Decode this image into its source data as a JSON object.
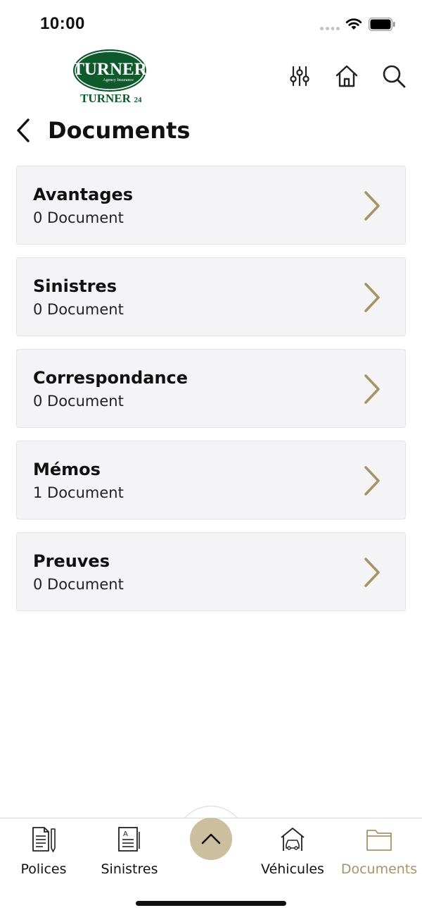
{
  "status_bar": {
    "time": "10:00"
  },
  "brand": {
    "logo_text": "TURNER",
    "logo_subtext": "Agency Insurance",
    "logo_tagline": "TURNER",
    "logo_tagline_suffix": "24"
  },
  "header": {
    "title": "Documents",
    "icons": [
      "sliders-icon",
      "home-icon",
      "search-icon"
    ]
  },
  "documents": [
    {
      "name": "Avantages",
      "count": "0 Document"
    },
    {
      "name": "Sinistres",
      "count": "0 Document"
    },
    {
      "name": "Correspondance",
      "count": "0 Document"
    },
    {
      "name": "Mémos",
      "count": "1 Document"
    },
    {
      "name": "Preuves",
      "count": "0 Document"
    }
  ],
  "tabs": {
    "polices": "Polices",
    "sinistres": "Sinistres",
    "vehicules": "Véhicules",
    "documents": "Documents",
    "active": "documents"
  },
  "colors": {
    "accent": "#a89368",
    "center_button": "#cbbf9f",
    "logo_green": "#0e5a2c",
    "card_background": "#f4f4f6"
  }
}
